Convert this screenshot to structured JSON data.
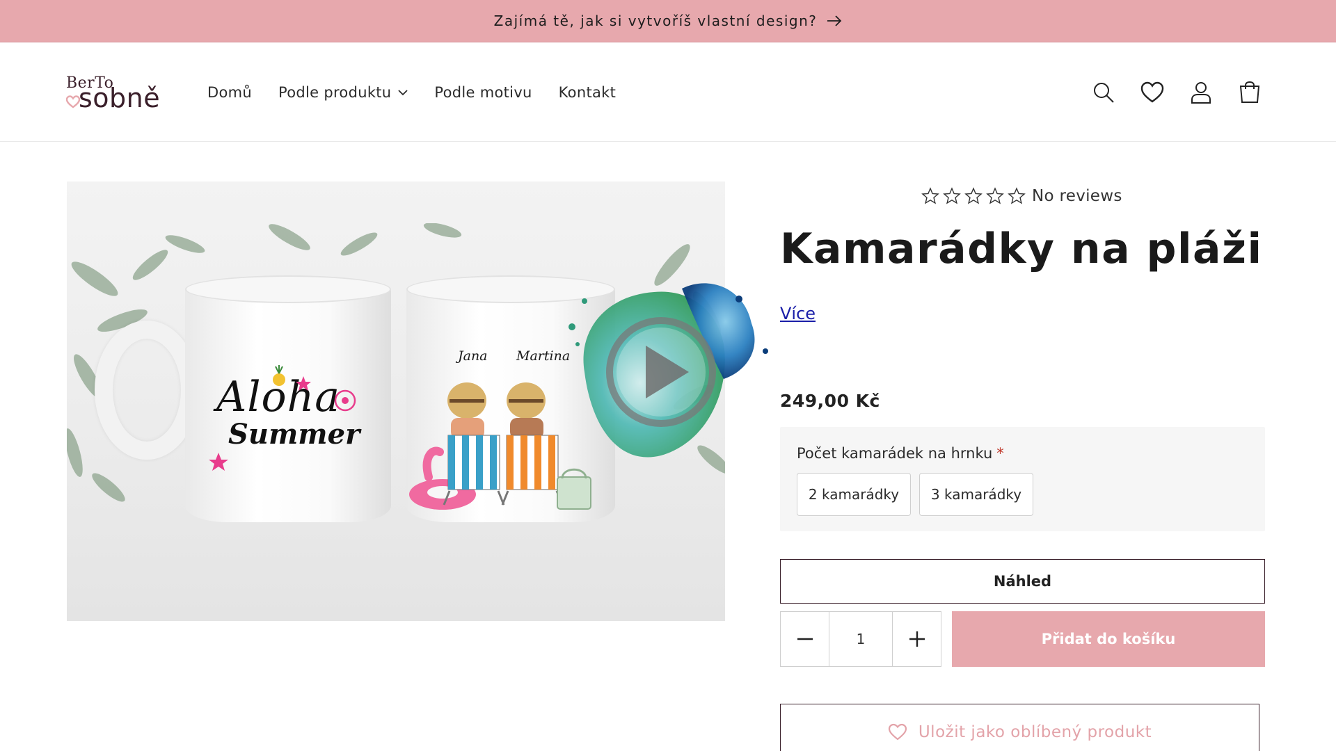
{
  "announcement": {
    "text": "Zajímá tě, jak si vytvoříš vlastní design?"
  },
  "logo": {
    "top": "BerTo",
    "main": "sobně"
  },
  "nav": {
    "items": [
      {
        "label": "Domů"
      },
      {
        "label": "Podle produktu"
      },
      {
        "label": "Podle motivu"
      },
      {
        "label": "Kontakt"
      }
    ]
  },
  "header_icons": [
    "search-icon",
    "heart-icon",
    "account-icon",
    "cart-icon"
  ],
  "media": {
    "left_mug_print": {
      "line1": "Aloha",
      "line2": "Summer"
    },
    "names": [
      "Jana",
      "Martina"
    ]
  },
  "product": {
    "reviews_text": "No reviews",
    "rating": 0,
    "title": "Kamarádky na pláži",
    "more_link": "Více",
    "price": "249,00 Kč",
    "option": {
      "label": "Počet kamarádek na hrnku",
      "required_mark": "*",
      "values": [
        "2 kamarádky",
        "3 kamarádky"
      ]
    },
    "preview_button": "Náhled",
    "quantity": "1",
    "add_to_cart": "Přidat do košíku",
    "save_favorite": "Uložit jako oblíbený produkt"
  },
  "colors": {
    "accent_pink": "#e7a8ad",
    "brand_dark": "#3a1f2a",
    "link_blue": "#1a1ea8"
  }
}
